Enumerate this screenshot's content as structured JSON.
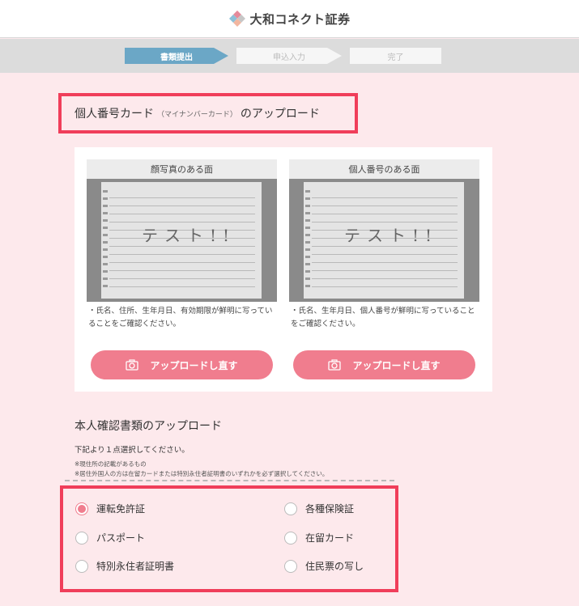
{
  "header": {
    "brand": "大和コネクト証券",
    "logo_icon": "daiwa-logo-icon"
  },
  "steps": [
    {
      "label": "書類提出",
      "state": "current"
    },
    {
      "label": "申込入力",
      "state": "upcoming"
    },
    {
      "label": "完了",
      "state": "upcoming"
    }
  ],
  "mynumber": {
    "title": "個人番号カード",
    "subtitle": "（マイナンバーカード）",
    "title_suffix": "のアップロード",
    "face_side": {
      "heading": "顔写真のある面",
      "note": "・氏名、住所、生年月日、有効期限が鮮明に写っていることをご確認ください。",
      "button": "アップロードし直す"
    },
    "number_side": {
      "heading": "個人番号のある面",
      "note": "・氏名、生年月日、個人番号が鮮明に写っていることをご確認ください。",
      "button": "アップロードし直す"
    },
    "photo_text": "テスト!!"
  },
  "identity": {
    "title": "本人確認書類のアップロード",
    "instruction": "下記より１点選択してください。",
    "note1": "※現住所の記載があるもの",
    "note2": "※居住外国人の方は在留カードまたは特別永住者証明書のいずれかを必ず選択してください。",
    "options": [
      {
        "label": "運転免許証",
        "selected": true
      },
      {
        "label": "各種保険証",
        "selected": false
      },
      {
        "label": "パスポート",
        "selected": false
      },
      {
        "label": "在留カード",
        "selected": false
      },
      {
        "label": "特別永住者証明書",
        "selected": false
      },
      {
        "label": "住民票の写し",
        "selected": false
      }
    ]
  },
  "colors": {
    "accent": "#f07d8e",
    "highlight_border": "#f03e5a",
    "step_active": "#6ba7c6",
    "background": "#fde9ec"
  }
}
